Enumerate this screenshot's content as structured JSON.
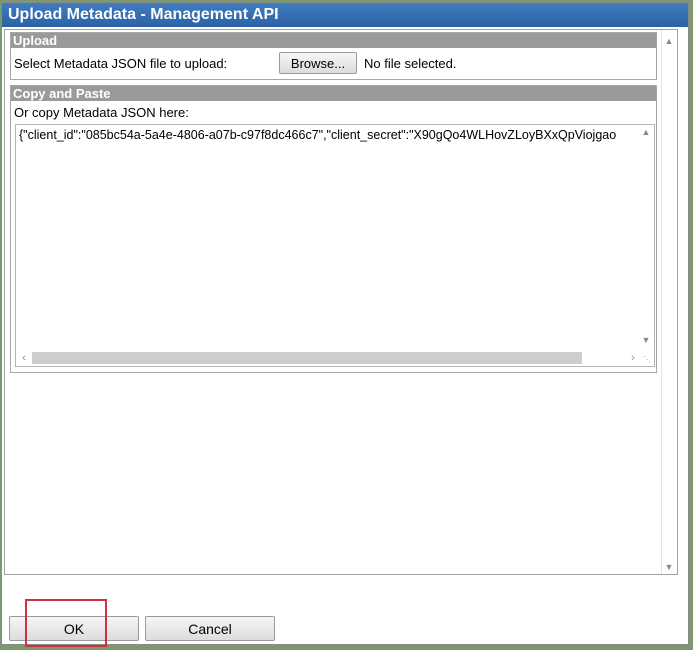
{
  "window": {
    "title": "Upload Metadata - Management API"
  },
  "upload": {
    "legend": "Upload",
    "select_label": "Select Metadata JSON file to upload:",
    "browse_label": "Browse...",
    "file_status": "No file selected."
  },
  "paste": {
    "legend": "Copy and Paste",
    "prompt": "Or copy Metadata JSON here:",
    "json_value": "{\"client_id\":\"085bc54a-5a4e-4806-a07b-c97f8dc466c7\",\"client_secret\":\"X90gQo4WLHovZLoyBXxQpViojgao"
  },
  "footer": {
    "ok_label": "OK",
    "cancel_label": "Cancel"
  },
  "colors": {
    "title_bar": "#2c62a5",
    "legend_bar": "#9a9a9a",
    "highlight": "#d2303e",
    "background": "#7a9a6e"
  }
}
